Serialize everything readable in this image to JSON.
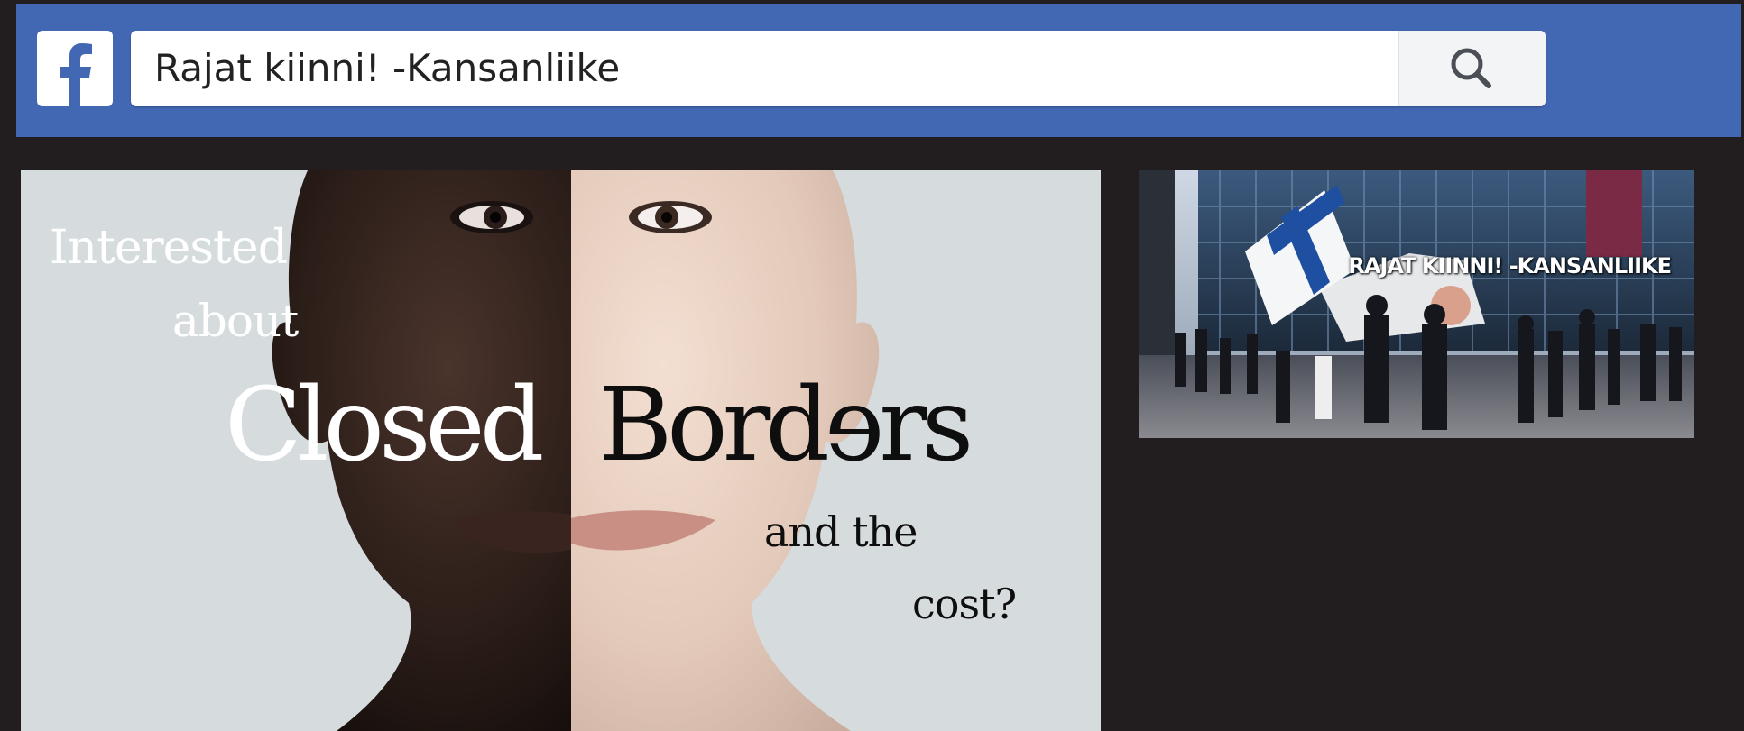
{
  "header": {
    "logo_icon": "facebook-f-icon",
    "brand_color": "#4268b4",
    "search": {
      "value": "Rajat kiinni! -Kansanliike",
      "button_icon": "search-icon"
    }
  },
  "main_image": {
    "lines": {
      "interested": "Interested",
      "about": "about",
      "closed": "Closed",
      "borders": "Bordɘrs",
      "and_the": "and the",
      "cost": "cost?"
    }
  },
  "side_image": {
    "overlay_text": "RAJAT KIINNI! -KANSANLIIKE"
  }
}
